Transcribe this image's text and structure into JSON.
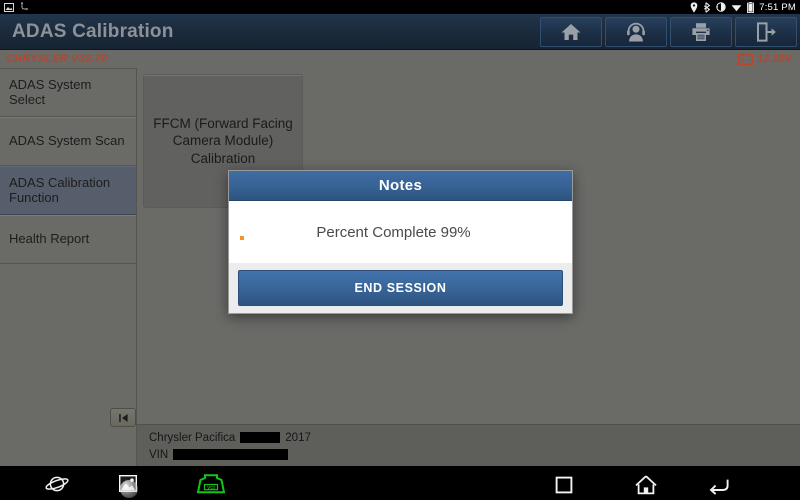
{
  "status_bar": {
    "time": "7:51 PM",
    "icons": [
      "location-pin-icon",
      "bluetooth-icon",
      "rotate-lock-icon",
      "wifi-icon",
      "battery-icon"
    ]
  },
  "header": {
    "title": "ADAS Calibration",
    "toolbar": [
      {
        "name": "home-button",
        "icon": "home-icon"
      },
      {
        "name": "support-button",
        "icon": "headset-person-icon"
      },
      {
        "name": "print-button",
        "icon": "printer-icon"
      },
      {
        "name": "exit-button",
        "icon": "exit-door-icon"
      }
    ]
  },
  "subheader": {
    "make_version": "CHRYSLER V33.70",
    "voltage": "12.15V",
    "voltage_icon": "car-battery-icon",
    "accent_color": "#b8452c"
  },
  "sidebar": {
    "items": [
      {
        "label": "ADAS System Select",
        "active": false
      },
      {
        "label": "ADAS System Scan",
        "active": false
      },
      {
        "label": "ADAS Calibration Function",
        "active": true
      },
      {
        "label": "Health Report",
        "active": false
      }
    ],
    "active_color": "#565e6b"
  },
  "main": {
    "tiles": [
      {
        "label": "FFCM (Forward Facing Camera Module) Calibration"
      }
    ],
    "collapse_button": {
      "name": "collapse-panel-button",
      "glyph": "❘◀"
    }
  },
  "vehicle_info": {
    "line1_prefix": "Chrysler Pacifica",
    "line1_suffix": "2017",
    "line1_redacted": true,
    "line2_label": "VIN",
    "line2_redacted": true
  },
  "dialog": {
    "title": "Notes",
    "message": "Percent Complete 99%",
    "percent_complete": 99,
    "bullet_color": "#f5922e",
    "button_label": "END SESSION",
    "header_color": "#376396",
    "button_color": "#39679b"
  },
  "nav_bar": {
    "items": [
      {
        "name": "browser-planet-icon"
      },
      {
        "name": "gallery-image-icon"
      },
      {
        "name": "vci-connector-icon",
        "color": "#16c416"
      },
      {
        "name": "recents-square-icon"
      },
      {
        "name": "android-home-icon"
      },
      {
        "name": "android-back-icon"
      }
    ]
  }
}
